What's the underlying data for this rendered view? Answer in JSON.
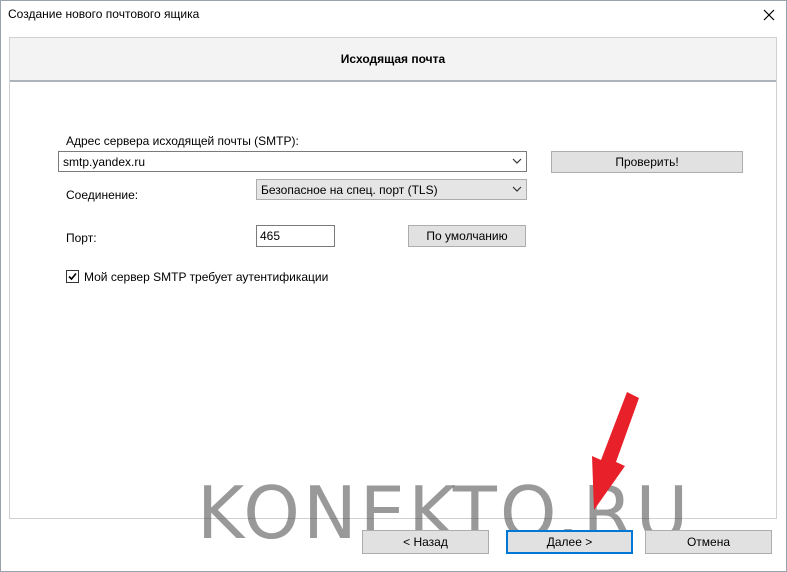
{
  "window": {
    "title": "Создание нового почтового ящика"
  },
  "header": {
    "title": "Исходящая почта"
  },
  "form": {
    "server_label": "Адрес сервера исходящей почты (SMTP):",
    "server_value": "smtp.yandex.ru",
    "check_button": "Проверить!",
    "connection_label": "Соединение:",
    "connection_value": "Безопасное на спец. порт (TLS)",
    "port_label": "Порт:",
    "port_value": "465",
    "default_button": "По умолчанию",
    "auth_checkbox_label": "Мой сервер SMTP требует аутентификации",
    "auth_checked": true
  },
  "footer": {
    "back_button": "<  Назад",
    "next_button": "Далее  >",
    "cancel_button": "Отмена"
  },
  "overlay": {
    "watermark": "KONEKTO.RU",
    "arrow_color": "#e8202a"
  }
}
